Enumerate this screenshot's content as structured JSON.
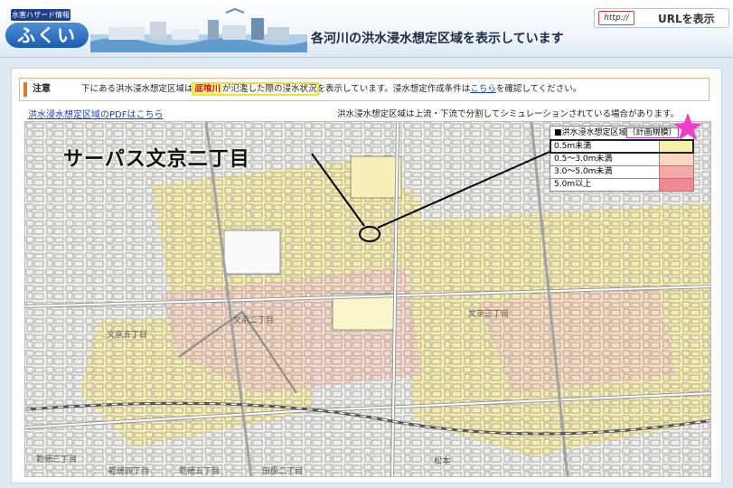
{
  "header": {
    "logo_sub": "水害ハザード情報",
    "logo_main": "ふくい",
    "title": "各河川の洪水浸水想定区域を表示しています",
    "url_icon": "http://",
    "url_label": "URLを表示"
  },
  "notice": {
    "tag": "注意",
    "text_before": "下にある洪水浸水想定区域は",
    "river": "底喰川",
    "text_highlight": "が氾濫した際の浸水状況",
    "text_after": "を表示しています。浸水想定作成条件は",
    "link": "こちら",
    "text_end": "を確認してください。"
  },
  "links": {
    "pdf": "洪水浸水想定区域のPDFはこちら",
    "split_note": "洪水浸水想定区域は上流・下流で分割してシミュレーションされている場合があります。"
  },
  "legend": {
    "head": "■洪水浸水想定区域",
    "plan": "（計画規模）",
    "rows": [
      {
        "label": "0.5m未満",
        "color": "#f7f0a8"
      },
      {
        "label": "0.5～3.0m未満",
        "color": "#f9d7c3"
      },
      {
        "label": "3.0～5.0m未満",
        "color": "#f4a8a8"
      },
      {
        "label": "5.0m以上",
        "color": "#ef8a92"
      }
    ]
  },
  "map": {
    "callout": "サーパス文京二丁目",
    "labels": [
      {
        "text": "文京二丁目"
      },
      {
        "text": "文京三丁目"
      },
      {
        "text": "文京五丁目"
      },
      {
        "text": "乾徳三丁目"
      },
      {
        "text": "乾徳四丁目"
      },
      {
        "text": "乾徳五丁目"
      },
      {
        "text": "田原二丁目"
      },
      {
        "text": "松本"
      }
    ]
  },
  "colors": {
    "accent": "#e27a25",
    "link": "#1a3fbd",
    "star": "#f03ec8",
    "flood_low": "#f7f0a8",
    "flood_mid": "#f9d7c3"
  }
}
